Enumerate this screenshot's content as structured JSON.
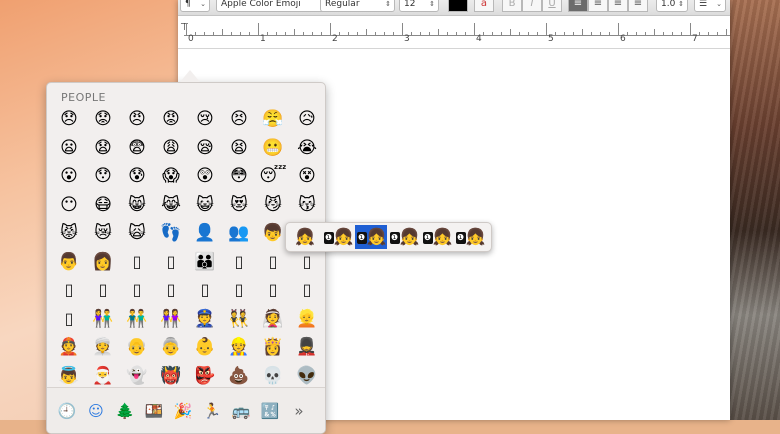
{
  "toolbar": {
    "paragraph_label": "¶",
    "font_family": "Apple Color Emoji",
    "font_style": "Regular",
    "font_size": "12",
    "bold": "B",
    "italic": "I",
    "underline": "U",
    "line_spacing": "1.0",
    "list_icon": "list-icon"
  },
  "ruler": {
    "numbers": [
      "0",
      "1",
      "2",
      "3",
      "4",
      "5",
      "6",
      "7"
    ]
  },
  "picker": {
    "section_title": "PEOPLE",
    "rows": [
      [
        "😞",
        "😟",
        "😠",
        "😡",
        "😢",
        "😣",
        "😤",
        "😥"
      ],
      [
        "😦",
        "😧",
        "😨",
        "😩",
        "😪",
        "😫",
        "😬",
        "😭"
      ],
      [
        "😮",
        "😯",
        "😰",
        "😱",
        "😲",
        "😳",
        "😴",
        "😵"
      ],
      [
        "😶",
        "😷",
        "😸",
        "😹",
        "😺",
        "😻",
        "😼",
        "😽"
      ],
      [
        "😾",
        "😿",
        "🙀",
        "👣",
        "👤",
        "👥",
        "👦",
        ""
      ],
      [
        "👨",
        "👩",
        "▯",
        "▯",
        "👪",
        "▯",
        "▯",
        "▯"
      ],
      [
        "▯",
        "▯",
        "▯",
        "▯",
        "▯",
        "▯",
        "▯",
        "▯"
      ],
      [
        "▯",
        "👫",
        "👬",
        "👭",
        "👮",
        "👯",
        "👰",
        "👱"
      ],
      [
        "👲",
        "👳",
        "👴",
        "👵",
        "👶",
        "👷",
        "👸",
        "💂"
      ],
      [
        "👼",
        "🎅",
        "👻",
        "👹",
        "👺",
        "💩",
        "💀",
        "👽"
      ]
    ],
    "categories": [
      {
        "name": "recents-icon",
        "glyph": "🕘"
      },
      {
        "name": "people-icon",
        "glyph": "☺"
      },
      {
        "name": "nature-icon",
        "glyph": "🌲"
      },
      {
        "name": "food-icon",
        "glyph": "🍱"
      },
      {
        "name": "celebration-icon",
        "glyph": "🎉"
      },
      {
        "name": "activity-icon",
        "glyph": "🏃"
      },
      {
        "name": "travel-icon",
        "glyph": "🚌"
      },
      {
        "name": "symbols-icon",
        "glyph": "🔣"
      },
      {
        "name": "more-icon",
        "glyph": "»"
      }
    ]
  },
  "variants": {
    "items": [
      "👧",
      "👧",
      "👧",
      "👧",
      "👧",
      "👧"
    ],
    "badge": "❶",
    "selected_index": 2
  },
  "colors": {
    "accent": "#1f5fd3",
    "active_category": "#2d7ae0"
  }
}
